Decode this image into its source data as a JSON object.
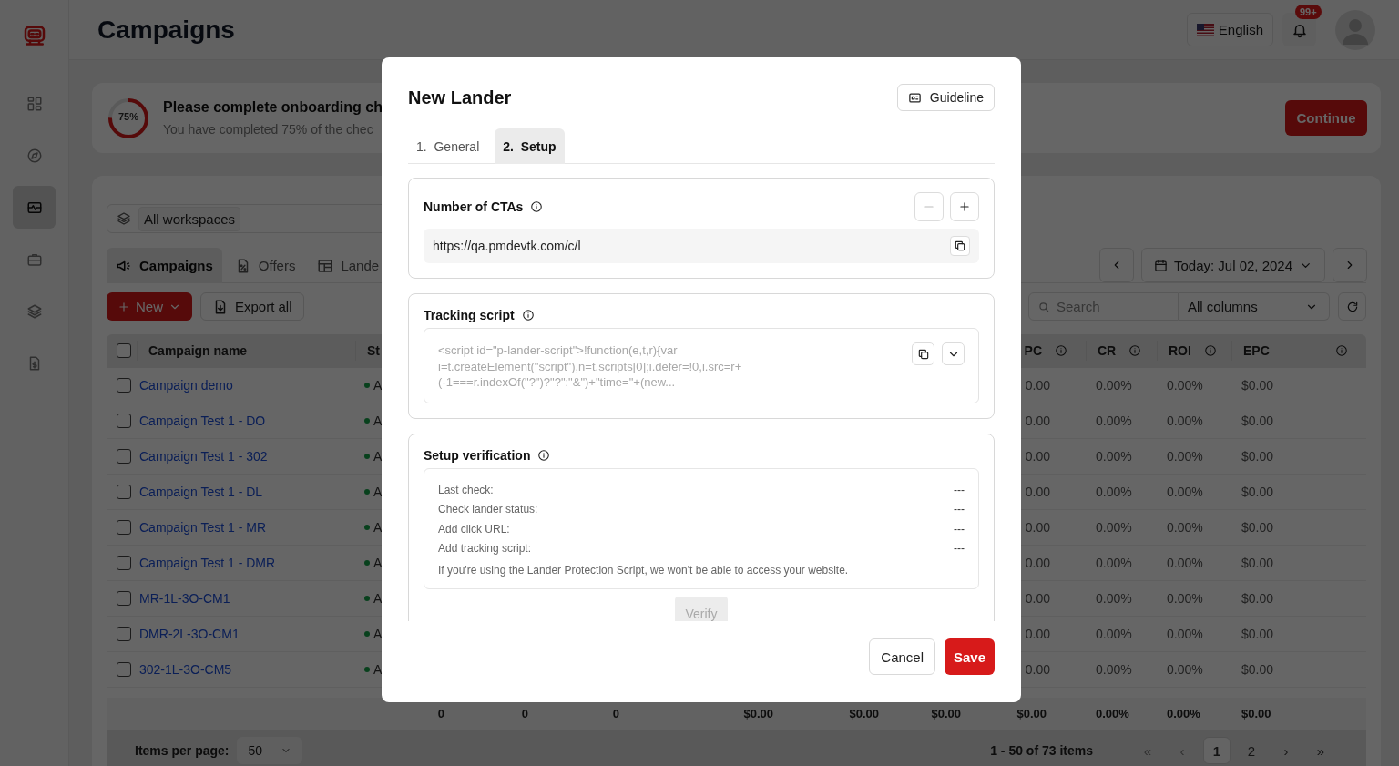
{
  "sidebar": {
    "items": [
      {
        "kind": "grid",
        "selected": false
      },
      {
        "kind": "compass",
        "selected": false
      },
      {
        "kind": "activity",
        "selected": true
      },
      {
        "kind": "briefcase",
        "selected": false
      },
      {
        "kind": "layers",
        "selected": false
      },
      {
        "kind": "invoice",
        "selected": false
      }
    ]
  },
  "header": {
    "title": "Campaigns",
    "language": "English",
    "notification_badge": "99+"
  },
  "onboarding": {
    "progress_label": "75%",
    "level": 0.75,
    "title": "Please complete onboarding ch",
    "subtitle": "You have completed 75% of the chec",
    "button": "Continue"
  },
  "workspace": "All workspaces",
  "tabs": [
    {
      "label": "Campaigns",
      "kind": "megaphone",
      "selected": true
    },
    {
      "label": "Offers",
      "kind": "percent",
      "selected": false
    },
    {
      "label": "Lande",
      "kind": "layout",
      "selected": false
    }
  ],
  "toolbar": {
    "new": "New",
    "export": "Export all",
    "date": "Today: Jul 02, 2024",
    "search_placeholder": "Search",
    "columns_filter": "All columns"
  },
  "table": {
    "columns": [
      {
        "label": "Campaign name",
        "info": false
      },
      {
        "label": "St",
        "info": false
      },
      {
        "label": "PC",
        "info": true
      },
      {
        "label": "CR",
        "info": true
      },
      {
        "label": "ROI",
        "info": true
      },
      {
        "label": "EPC",
        "info": true
      }
    ],
    "rows": [
      {
        "checked": false,
        "name": "Campaign demo",
        "status": "A",
        "cpc": "0.00",
        "cr": "0.00%",
        "roi": "0.00%",
        "epc": "$0.00"
      },
      {
        "checked": false,
        "name": "Campaign Test 1 - DO",
        "status": "A",
        "cpc": "0.00",
        "cr": "0.00%",
        "roi": "0.00%",
        "epc": "$0.00"
      },
      {
        "checked": false,
        "name": "Campaign Test 1 - 302",
        "status": "A",
        "cpc": "0.00",
        "cr": "0.00%",
        "roi": "0.00%",
        "epc": "$0.00"
      },
      {
        "checked": false,
        "name": "Campaign Test 1 - DL",
        "status": "A",
        "cpc": "0.00",
        "cr": "0.00%",
        "roi": "0.00%",
        "epc": "$0.00"
      },
      {
        "checked": false,
        "name": "Campaign Test 1 - MR",
        "status": "A",
        "cpc": "0.00",
        "cr": "0.00%",
        "roi": "0.00%",
        "epc": "$0.00"
      },
      {
        "checked": false,
        "name": "Campaign Test 1 - DMR",
        "status": "A",
        "cpc": "0.00",
        "cr": "0.00%",
        "roi": "0.00%",
        "epc": "$0.00"
      },
      {
        "checked": false,
        "name": "MR-1L-3O-CM1",
        "status": "A",
        "cpc": "0.00",
        "cr": "0.00%",
        "roi": "0.00%",
        "epc": "$0.00"
      },
      {
        "checked": false,
        "name": "DMR-2L-3O-CM1",
        "status": "A",
        "cpc": "0.00",
        "cr": "0.00%",
        "roi": "0.00%",
        "epc": "$0.00"
      },
      {
        "checked": false,
        "name": "302-1L-3O-CM5",
        "status": "A",
        "cpc": "0.00",
        "cr": "0.00%",
        "roi": "0.00%",
        "epc": "$0.00"
      }
    ],
    "select_all_checked": false,
    "totals": [
      "0",
      "0",
      "0",
      "$0.00",
      "$0.00",
      "$0.00",
      "$0.00",
      "0.00%",
      "0.00%",
      "$0.00"
    ]
  },
  "footer": {
    "items_per_page_label": "Items per page:",
    "page_size": "50",
    "range": "1 - 50 of 73 items",
    "first": {
      "label": "«",
      "disabled": true
    },
    "previous": {
      "label": "‹",
      "disabled": true
    },
    "pages": [
      {
        "label": "1",
        "selected": true
      },
      {
        "label": "2",
        "selected": false
      }
    ],
    "next": {
      "label": "›",
      "disabled": false
    },
    "last": {
      "label": "»",
      "disabled": false
    }
  },
  "modal": {
    "title": "New Lander",
    "guideline": "Guideline",
    "steps": [
      {
        "number": "1.",
        "label": "General",
        "selected": false
      },
      {
        "number": "2.",
        "label": "Setup",
        "selected": true
      }
    ],
    "ctas": {
      "title": "Number of CTAs",
      "minus_disabled": true,
      "url": "https://qa.pmdevtk.com/c/l"
    },
    "tracking": {
      "title": "Tracking script",
      "script_lines": [
        "<script id=\"p-lander-script\">!function(e,t,r){var",
        "i=t.createElement(\"script\"),n=t.scripts[0];i.defer=!0,i.src=r+",
        "(-1===r.indexOf(\"?\")?\"?\":\"&\")+\"time=\"+(new..."
      ]
    },
    "verification": {
      "title": "Setup verification",
      "checks": [
        {
          "label": "Last check:",
          "value": "---"
        },
        {
          "label": "Check lander status:",
          "value": "---"
        },
        {
          "label": "Add click URL:",
          "value": "---"
        },
        {
          "label": "Add tracking script:",
          "value": "---"
        }
      ],
      "note": "If you're using the Lander Protection Script, we won't be able to access your website.",
      "verify": "Verify",
      "verify_disabled": true
    },
    "cancel": "Cancel",
    "save": "Save"
  }
}
